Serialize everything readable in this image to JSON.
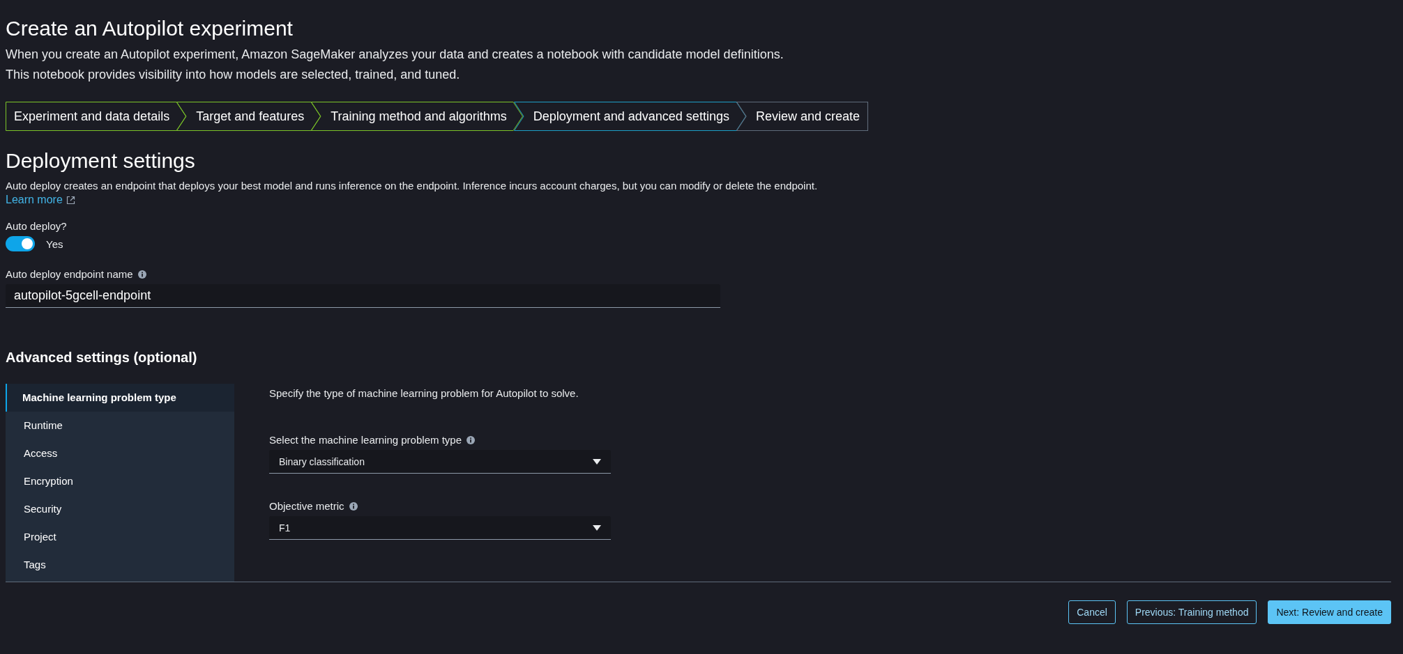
{
  "page": {
    "title": "Create an Autopilot experiment",
    "description": [
      "When you create an Autopilot experiment, Amazon SageMaker analyzes your data and creates a notebook with candidate model definitions.",
      "This notebook provides visibility into how models are selected, trained, and tuned."
    ]
  },
  "steps": [
    {
      "label": "Experiment and data details",
      "completed": true,
      "selected": false
    },
    {
      "label": "Target and features",
      "completed": true,
      "selected": false
    },
    {
      "label": "Training method and algorithms",
      "completed": true,
      "selected": false
    },
    {
      "label": "Deployment and advanced settings",
      "completed": false,
      "selected": true
    },
    {
      "label": "Review and create",
      "completed": false,
      "selected": false
    }
  ],
  "deployment": {
    "heading": "Deployment settings",
    "description": "Auto deploy creates an endpoint that deploys your best model and runs inference on the endpoint. Inference incurs account charges, but you can modify or delete the endpoint.",
    "learn_more": "Learn more",
    "auto_deploy": {
      "label": "Auto deploy?",
      "on": true,
      "value_label": "Yes"
    },
    "endpoint_name": {
      "label": "Auto deploy endpoint name",
      "value": "autopilot-5gcell-endpoint"
    }
  },
  "advanced": {
    "heading": "Advanced settings (optional)",
    "sidebar": [
      {
        "label": "Machine learning problem type",
        "selected": true
      },
      {
        "label": "Runtime",
        "selected": false
      },
      {
        "label": "Access",
        "selected": false
      },
      {
        "label": "Encryption",
        "selected": false
      },
      {
        "label": "Security",
        "selected": false
      },
      {
        "label": "Project",
        "selected": false
      },
      {
        "label": "Tags",
        "selected": false
      }
    ],
    "description": "Specify the type of machine learning problem for Autopilot to solve.",
    "fields": [
      {
        "label": "Select the machine learning problem type",
        "value": "Binary classification"
      },
      {
        "label": "Objective metric",
        "value": "F1"
      }
    ]
  },
  "footer": {
    "buttons": [
      {
        "label": "Cancel",
        "kind": "outline"
      },
      {
        "label": "Previous: Training method",
        "kind": "outline"
      },
      {
        "label": "Next: Review and create",
        "kind": "primary"
      }
    ]
  }
}
